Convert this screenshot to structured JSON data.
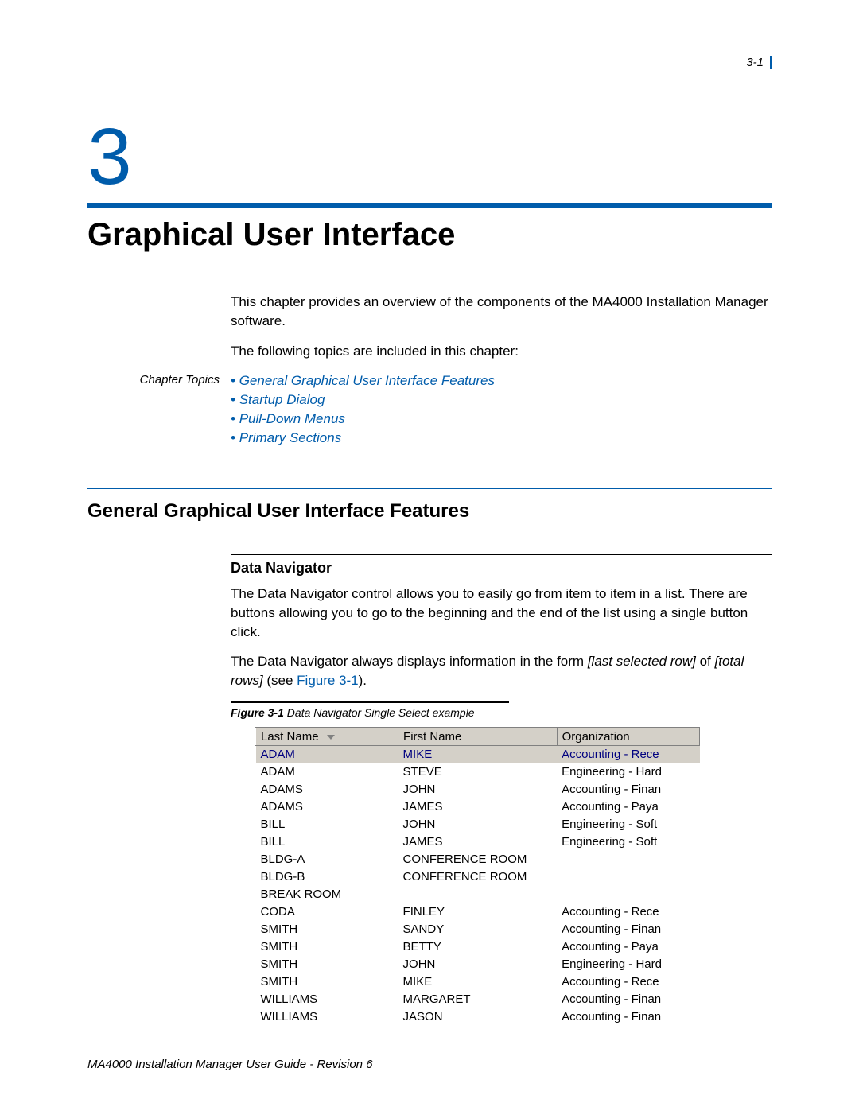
{
  "page_number_top": "3-1",
  "chapter_number": "3",
  "chapter_title": "Graphical User Interface",
  "intro_p1": "This chapter provides an overview of the components of the MA4000 Installation Manager software.",
  "intro_p2": "The following topics are included in this chapter:",
  "topics_label": "Chapter Topics",
  "topics": [
    "General Graphical User Interface Features",
    "Startup Dialog",
    "Pull-Down Menus",
    "Primary Sections"
  ],
  "section_heading": "General Graphical User Interface Features",
  "subsection_heading": "Data Navigator",
  "para1": "The Data Navigator control allows you to easily go from item to item in a list. There are buttons allowing you to go to the beginning and the end of the list using a single button click.",
  "para2_prefix": "The Data Navigator always displays information in the form ",
  "para2_ital1": "[last selected row]",
  "para2_mid": " of ",
  "para2_ital2": "[total rows]",
  "para2_after": " (see ",
  "para2_link": "Figure 3-1",
  "para2_end": ").",
  "figure_label": "Figure 3-1",
  "figure_caption": "  Data Navigator Single Select example",
  "table": {
    "columns": [
      "Last Name",
      "First Name",
      "Organization"
    ],
    "rows": [
      {
        "last": "ADAM",
        "first": "MIKE",
        "org": "Accounting - Rece",
        "selected": true
      },
      {
        "last": "ADAM",
        "first": "STEVE",
        "org": "Engineering - Hard"
      },
      {
        "last": "ADAMS",
        "first": "JOHN",
        "org": "Accounting - Finan"
      },
      {
        "last": "ADAMS",
        "first": "JAMES",
        "org": "Accounting - Paya"
      },
      {
        "last": "BILL",
        "first": "JOHN",
        "org": "Engineering - Soft"
      },
      {
        "last": "BILL",
        "first": "JAMES",
        "org": "Engineering - Soft"
      },
      {
        "last": "BLDG-A",
        "first": "CONFERENCE ROOM",
        "org": ""
      },
      {
        "last": "BLDG-B",
        "first": "CONFERENCE ROOM",
        "org": ""
      },
      {
        "last": "BREAK ROOM",
        "first": "",
        "org": ""
      },
      {
        "last": "CODA",
        "first": "FINLEY",
        "org": "Accounting - Rece"
      },
      {
        "last": "SMITH",
        "first": "SANDY",
        "org": "Accounting - Finan"
      },
      {
        "last": "SMITH",
        "first": "BETTY",
        "org": "Accounting - Paya"
      },
      {
        "last": "SMITH",
        "first": "JOHN",
        "org": "Engineering - Hard"
      },
      {
        "last": "SMITH",
        "first": "MIKE",
        "org": "Accounting - Rece"
      },
      {
        "last": "WILLIAMS",
        "first": "MARGARET",
        "org": "Accounting - Finan"
      },
      {
        "last": "WILLIAMS",
        "first": "JASON",
        "org": "Accounting - Finan"
      }
    ]
  },
  "footer": "MA4000 Installation Manager User Guide - Revision 6"
}
